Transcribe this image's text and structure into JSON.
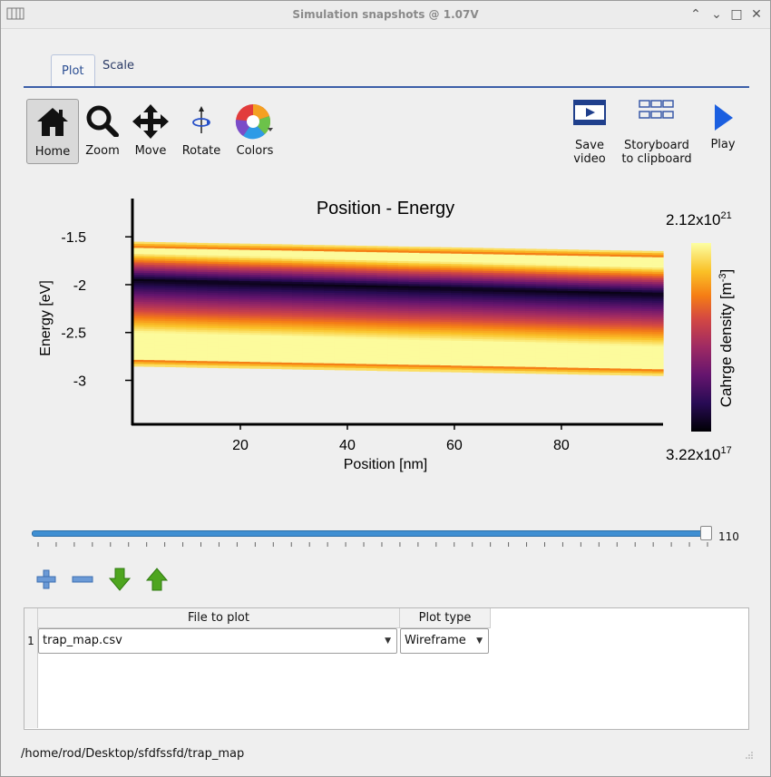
{
  "window": {
    "title": "Simulation snapshots @ 1.07V"
  },
  "tabs": [
    {
      "label": "Plot",
      "active": true
    },
    {
      "label": "Scale",
      "active": false
    }
  ],
  "toolbar": {
    "home": "Home",
    "zoom": "Zoom",
    "move": "Move",
    "rotate": "Rotate",
    "colors": "Colors",
    "save_video": [
      "Save",
      "video"
    ],
    "storyboard": [
      "Storyboard",
      "to clipboard"
    ],
    "play": "Play"
  },
  "chart_data": {
    "type": "heatmap",
    "title": "Position - Energy",
    "xlabel": "Position [nm]",
    "ylabel": "Energy [eV]",
    "x_ticks": [
      "20",
      "40",
      "60",
      "80"
    ],
    "y_ticks": [
      "-1.5",
      "-2",
      "-2.5",
      "-3"
    ],
    "x_range": [
      0,
      99
    ],
    "y_range": [
      -3.45,
      -1.1
    ],
    "colorbar": {
      "label": "Cahrge density [m",
      "label_sup": "-3",
      "label_end": "]",
      "max_base": "2.12x10",
      "max_exp": "21",
      "min_base": "3.22x10",
      "min_exp": "17"
    },
    "colormap": "inferno",
    "bands": {
      "top_edge": [
        [
          0,
          -1.55
        ],
        [
          99,
          -1.65
        ]
      ],
      "bottom_edge": [
        [
          0,
          -2.85
        ],
        [
          99,
          -2.95
        ]
      ],
      "dark_core": [
        [
          0,
          -1.95
        ],
        [
          99,
          -2.1
        ]
      ]
    }
  },
  "slider": {
    "value": "110",
    "fraction": 0.99
  },
  "edit_buttons": [
    "plus-icon",
    "minus-icon",
    "arrow-down-icon",
    "arrow-up-icon"
  ],
  "table": {
    "headers": [
      "File to plot",
      "Plot type"
    ],
    "rows": [
      {
        "index": "1",
        "file": "trap_map.csv",
        "type": "Wireframe"
      }
    ]
  },
  "status": {
    "path": "/home/rod/Desktop/sfdfssfd/trap_map"
  },
  "colors": {
    "accent": "#3c5fa8",
    "play": "#1b5fe0",
    "arrows": "#4ea51f"
  }
}
